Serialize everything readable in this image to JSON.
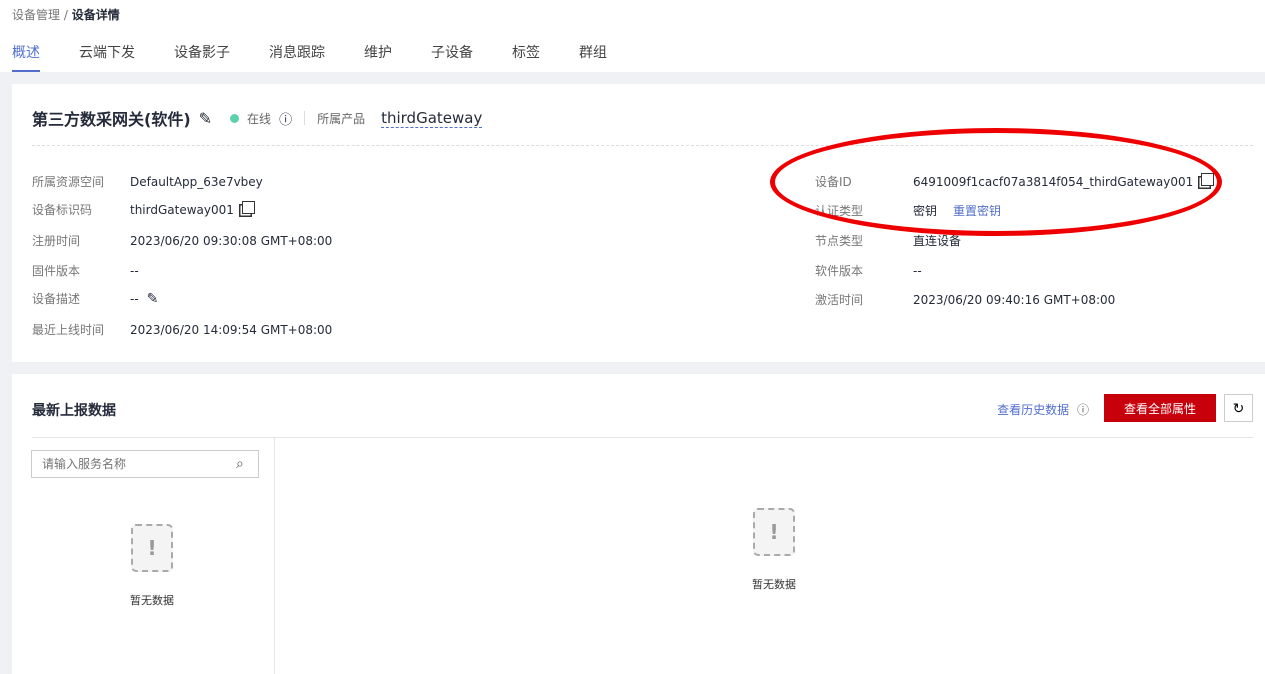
{
  "breadcrumb": {
    "parent": "设备管理",
    "current": "设备详情"
  },
  "tabs": [
    "概述",
    "云端下发",
    "设备影子",
    "消息跟踪",
    "维护",
    "子设备",
    "标签",
    "群组"
  ],
  "device": {
    "name": "第三方数采网关(软件)",
    "status": "在线",
    "product_label": "所属产品",
    "product": "thirdGateway"
  },
  "left": [
    {
      "label": "所属资源空间",
      "value": "DefaultApp_63e7vbey"
    },
    {
      "label": "设备标识码",
      "value": "thirdGateway001"
    },
    {
      "label": "注册时间",
      "value": "2023/06/20 09:30:08 GMT+08:00"
    },
    {
      "label": "固件版本",
      "value": "--"
    },
    {
      "label": "设备描述",
      "value": "--"
    },
    {
      "label": "最近上线时间",
      "value": "2023/06/20 14:09:54 GMT+08:00"
    }
  ],
  "right": [
    {
      "label": "设备ID",
      "value": "6491009f1cacf07a3814f054_thirdGateway001"
    },
    {
      "label": "认证类型",
      "value": "密钥",
      "link": "重置密钥"
    },
    {
      "label": "节点类型",
      "value": "直连设备"
    },
    {
      "label": "软件版本",
      "value": "--"
    },
    {
      "label": "激活时间",
      "value": "2023/06/20 09:40:16 GMT+08:00"
    }
  ],
  "report": {
    "title": "最新上报数据",
    "history": "查看历史数据",
    "all_props": "查看全部属性",
    "search_placeholder": "请输入服务名称",
    "empty": "暂无数据"
  }
}
